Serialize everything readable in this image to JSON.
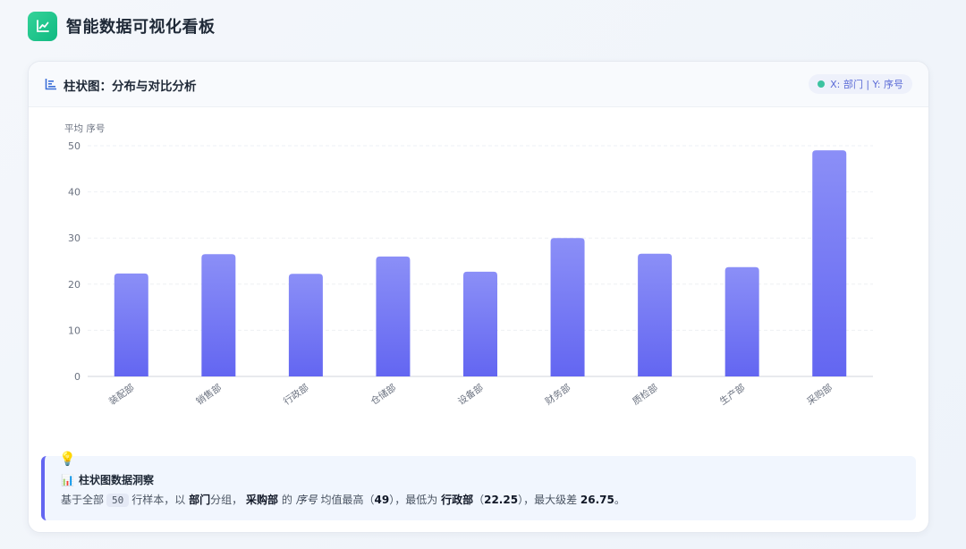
{
  "header": {
    "title": "智能数据可视化看板",
    "logo_icon": "line-chart-icon"
  },
  "card": {
    "title": "柱状图：分布与对比分析",
    "title_icon": "bar-chart-icon",
    "badge_text": "X: 部门 | Y: 序号"
  },
  "chart_data": {
    "type": "bar",
    "ylabel": "平均 序号",
    "xlabel": "",
    "ylim": [
      0,
      50
    ],
    "yticks": [
      0,
      10,
      20,
      30,
      40,
      50
    ],
    "categories": [
      "装配部",
      "销售部",
      "行政部",
      "仓储部",
      "设备部",
      "财务部",
      "质检部",
      "生产部",
      "采购部"
    ],
    "values": [
      22.3,
      26.5,
      22.25,
      26.0,
      22.7,
      30.0,
      26.6,
      23.7,
      49
    ],
    "bar_color_top": "#8b8ff7",
    "bar_color_bottom": "#6366f1",
    "grid": true
  },
  "insight": {
    "title": "柱状图数据洞察",
    "text_prefix": "基于全部",
    "sample_count": "50",
    "text_rows": "行样本，以",
    "group_field": "部门",
    "text_group": "分组，",
    "max_category": "采购部",
    "text_of": "的",
    "metric": "序号",
    "text_max": "均值最高（",
    "max_value": "49",
    "text_min": "），最低为",
    "min_category": "行政部",
    "text_paren_open": "（",
    "min_value": "22.25",
    "text_range": "），最大级差",
    "range_value": "26.75",
    "text_end": "。"
  }
}
